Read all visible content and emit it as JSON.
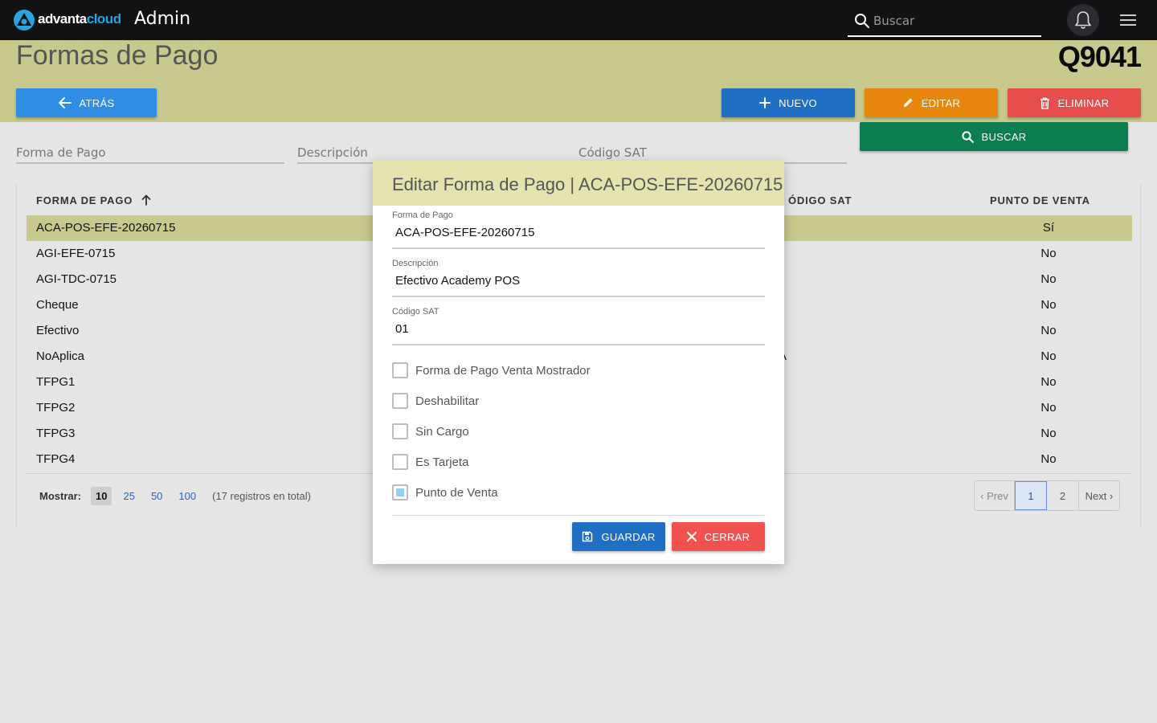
{
  "topbar": {
    "brand_main": "advanta",
    "brand_accent": "cloud",
    "app_title": "Admin",
    "search_placeholder": "Buscar"
  },
  "header": {
    "title": "Formas de Pago",
    "code": "Q9041"
  },
  "actions": {
    "back": "ATRÁS",
    "new": "NUEVO",
    "edit": "EDITAR",
    "delete": "ELIMINAR",
    "search": "BUSCAR"
  },
  "filters": {
    "forma_pago": "Forma de Pago",
    "descripcion": "Descripción",
    "codigo_sat": "Código SAT"
  },
  "table": {
    "headers": {
      "forma_pago": "FORMA DE PAGO",
      "codigo_sat_partial": "ÓDIGO SAT",
      "punto_venta": "PUNTO DE VENTA"
    },
    "rows": [
      {
        "forma": "ACA-POS-EFE-20260715",
        "sat": "",
        "pv": "Sí",
        "selected": true
      },
      {
        "forma": "AGI-EFE-0715",
        "sat": ".",
        "pv": "No"
      },
      {
        "forma": "AGI-TDC-0715",
        "sat": ".",
        "pv": "No"
      },
      {
        "forma": "Cheque",
        "sat": ".",
        "pv": "No"
      },
      {
        "forma": "Efectivo",
        "sat": ".",
        "pv": "No"
      },
      {
        "forma": "NoAplica",
        "sat": "A",
        "pv": "No"
      },
      {
        "forma": "TFPG1",
        "sat": ".",
        "pv": "No"
      },
      {
        "forma": "TFPG2",
        "sat": ".",
        "pv": "No"
      },
      {
        "forma": "TFPG3",
        "sat": ".",
        "pv": "No"
      },
      {
        "forma": "TFPG4",
        "sat": ".",
        "pv": "No"
      }
    ]
  },
  "pagination": {
    "show_label": "Mostrar:",
    "sizes": [
      "10",
      "25",
      "50",
      "100"
    ],
    "active_size": "10",
    "total": "(17 registros en total)",
    "prev": "‹ Prev",
    "pages": [
      "1",
      "2"
    ],
    "current_page": "1",
    "next": "Next ›"
  },
  "modal": {
    "title": "Editar Forma de Pago | ACA-POS-EFE-20260715",
    "fields": {
      "forma_pago_label": "Forma de Pago",
      "forma_pago_value": "ACA-POS-EFE-20260715",
      "descripcion_label": "Descripción",
      "descripcion_value": "Efectivo Academy POS",
      "codigo_sat_label": "Código SAT",
      "codigo_sat_value": "01"
    },
    "checkboxes": [
      {
        "label": "Forma de Pago Venta Mostrador",
        "checked": false
      },
      {
        "label": "Deshabilitar",
        "checked": false
      },
      {
        "label": "Sin Cargo",
        "checked": false
      },
      {
        "label": "Es Tarjeta",
        "checked": false
      },
      {
        "label": "Punto de Venta",
        "checked": true
      }
    ],
    "save": "GUARDAR",
    "close": "CERRAR"
  },
  "colors": {
    "topbar": "#111214",
    "header_band": "#c8c98c",
    "modal_header": "#e4e4ae",
    "btn_back": "#2f8de4",
    "btn_new": "#1f6fc4",
    "btn_edit": "#e7870d",
    "btn_delete": "#e64d4d",
    "btn_search": "#0b7d4f",
    "btn_close": "#f2524f"
  }
}
